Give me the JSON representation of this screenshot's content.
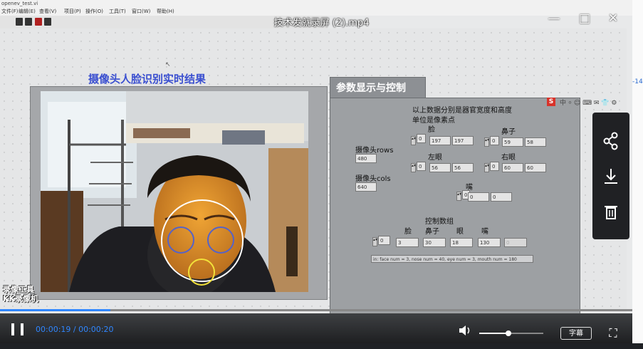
{
  "window": {
    "file_title": "openev_test.vi"
  },
  "menubar": {
    "items": [
      "文件(F)",
      "编辑(E)",
      "查看(V)",
      "项目(P)",
      "操作(O)",
      "工具(T)",
      "窗口(W)",
      "帮助(H)"
    ]
  },
  "video": {
    "title": "技术发就录屏 (2).mp4",
    "time": "00:00:19 / 00:00:20",
    "progress": 0.175,
    "volume": 0.45,
    "subtitle_button": "字幕"
  },
  "front_panel": {
    "heading": "摄像头人脸识别实时结果",
    "tab_label": "参数显示与控制",
    "note_line1": "以上数据分别是器官宽度和高度",
    "note_line2": "单位是像素点",
    "rows_label": "摄像头rows",
    "rows_value": "480",
    "cols_label": "摄像头cols",
    "cols_value": "640",
    "face": {
      "label": "脸",
      "index": "0",
      "v1": "197",
      "v2": "197"
    },
    "nose": {
      "label": "鼻子",
      "index": "0",
      "v1": "59",
      "v2": "58"
    },
    "left_eye": {
      "label": "左眼",
      "index": "0",
      "v1": "56",
      "v2": "56"
    },
    "right_eye": {
      "label": "右眼",
      "index": "0",
      "v1": "60",
      "v2": "60"
    },
    "mouth": {
      "label": "嘴",
      "index": "0",
      "v1": "0",
      "v2": "0"
    },
    "control": {
      "title": "控制数组",
      "headers": [
        "脸",
        "鼻子",
        "眼",
        "嘴"
      ],
      "index": "0",
      "values": [
        "3",
        "30",
        "18",
        "130",
        "0"
      ]
    },
    "status": "in: face num = 3, nose num = 40, eye num = 3, mouth num = 180"
  },
  "watermark": {
    "line1": "录像工具",
    "line2": "KK录像机"
  },
  "side_actions": [
    "share-icon",
    "download-icon",
    "delete-icon"
  ],
  "edge_text": "-14"
}
